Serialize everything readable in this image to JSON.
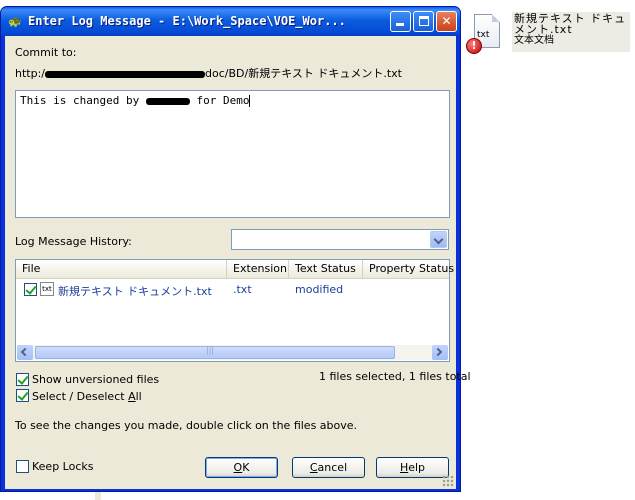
{
  "desktop": {
    "icon_ext": "txt",
    "file_name": "新規テキスト ドキュメント.txt",
    "file_type": "文本文档",
    "error_badge": "!"
  },
  "window": {
    "title": "Enter Log Message - E:\\Work_Space\\VOE_Wor...",
    "buttons": {
      "minimize": "_",
      "maximize": "□",
      "close": "✕"
    }
  },
  "commit": {
    "label": "Commit to:",
    "url_prefix": "http:/",
    "url_suffix": "doc/BD/新規テキスト ドキュメント.txt"
  },
  "message": {
    "text_before": "This is changed by",
    "text_after": "for Demo"
  },
  "history": {
    "label": "Log Message History:",
    "value": ""
  },
  "file_list": {
    "columns": [
      "File",
      "Extension",
      "Text Status",
      "Property Status"
    ],
    "rows": [
      {
        "icon": "txt",
        "file": "新規テキスト ドキュメント.txt",
        "extension": ".txt",
        "text_status": "modified",
        "property_status": "",
        "checked": true
      }
    ],
    "scroll_grip": "|||"
  },
  "options": {
    "show_unversioned": "Show unversioned files",
    "select_all_pre": "Select / Deselect ",
    "select_all_ul": "A",
    "select_all_post": "ll",
    "selection_status": "1 files selected, 1 files total",
    "hint": "To see the changes you made, double click on the files above.",
    "keep_locks": "Keep Locks"
  },
  "buttons": {
    "ok_ul": "O",
    "ok_rest": "K",
    "cancel_ul": "C",
    "cancel_rest": "ancel",
    "help_ul": "H",
    "help_rest": "elp"
  }
}
